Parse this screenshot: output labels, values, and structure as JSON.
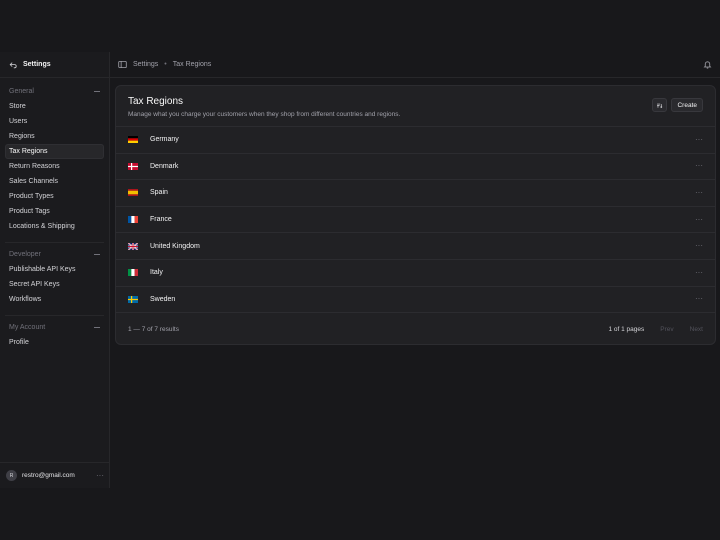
{
  "sidebar": {
    "header_label": "Settings",
    "sections": [
      {
        "title": "General",
        "items": [
          "Store",
          "Users",
          "Regions",
          "Tax Regions",
          "Return Reasons",
          "Sales Channels",
          "Product Types",
          "Product Tags",
          "Locations & Shipping"
        ]
      },
      {
        "title": "Developer",
        "items": [
          "Publishable API Keys",
          "Secret API Keys",
          "Workflows"
        ]
      },
      {
        "title": "My Account",
        "items": [
          "Profile"
        ]
      }
    ],
    "active_item": "Tax Regions",
    "user": {
      "avatar_letter": "R",
      "email": "restro@gmail.com"
    }
  },
  "topbar": {
    "breadcrumb": [
      "Settings",
      "Tax Regions"
    ],
    "separator": "•"
  },
  "card": {
    "title": "Tax Regions",
    "subtitle": "Manage what you charge your customers when they shop from different countries and regions.",
    "create_label": "Create",
    "rows": [
      {
        "name": "Germany",
        "flag": "de"
      },
      {
        "name": "Denmark",
        "flag": "dk"
      },
      {
        "name": "Spain",
        "flag": "es"
      },
      {
        "name": "France",
        "flag": "fr"
      },
      {
        "name": "United Kingdom",
        "flag": "gb"
      },
      {
        "name": "Italy",
        "flag": "it"
      },
      {
        "name": "Sweden",
        "flag": "se"
      }
    ],
    "row_menu": "···",
    "footer": {
      "range": "1 — 7 of 7 results",
      "pages": "1 of 1 pages",
      "prev": "Prev",
      "next": "Next"
    }
  },
  "colors": {
    "background": "#18181b",
    "card": "#212124",
    "border": "#2c2c30",
    "active": "#27272a"
  }
}
